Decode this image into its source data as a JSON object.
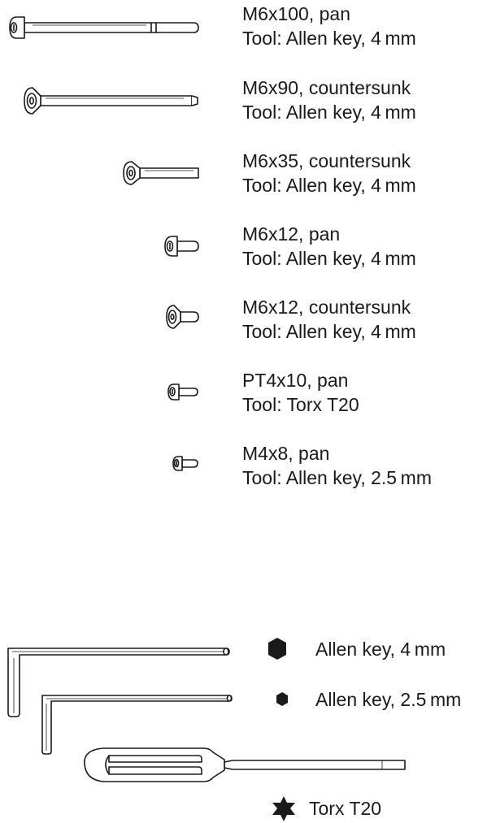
{
  "screws": [
    {
      "spec": "M6x100, pan",
      "tool": "Tool: Allen key, 4 mm",
      "icon": "pan-head-screw-icon"
    },
    {
      "spec": "M6x90, countersunk",
      "tool": "Tool: Allen key, 4 mm",
      "icon": "countersunk-screw-icon"
    },
    {
      "spec": "M6x35, countersunk",
      "tool": "Tool: Allen key, 4 mm",
      "icon": "countersunk-screw-icon"
    },
    {
      "spec": "M6x12, pan",
      "tool": "Tool: Allen key, 4 mm",
      "icon": "pan-head-screw-icon"
    },
    {
      "spec": "M6x12, countersunk",
      "tool": "Tool: Allen key, 4 mm",
      "icon": "countersunk-screw-icon"
    },
    {
      "spec": "PT4x10, pan",
      "tool": "Tool: Torx T20",
      "icon": "pan-head-screw-icon"
    },
    {
      "spec": "M4x8, pan",
      "tool": "Tool: Allen key, 2.5 mm",
      "icon": "pan-head-screw-icon"
    }
  ],
  "tools": [
    {
      "label": "Allen key, 4 mm",
      "icon": "large-hexagon-icon"
    },
    {
      "label": "Allen key, 2.5 mm",
      "icon": "small-hexagon-icon"
    },
    {
      "label": "Torx T20",
      "icon": "torx-star-icon"
    }
  ],
  "colors": {
    "stroke": "#1a1a1a",
    "fill": "#ffffff"
  }
}
